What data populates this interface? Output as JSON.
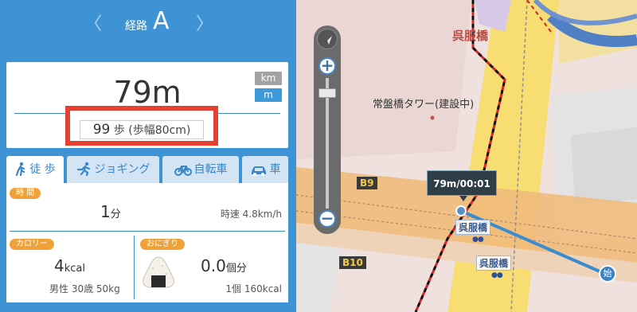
{
  "route": {
    "label": "経路",
    "letter": "A",
    "prev_icon": "chevron-left-icon",
    "next_icon": "chevron-right-icon",
    "prev_glyph": "〈",
    "next_glyph": "〉"
  },
  "distance": {
    "value": "79m",
    "unit_km": "km",
    "unit_m": "m",
    "selected_unit": "m"
  },
  "steps": {
    "count": "99",
    "unit": " 歩 ",
    "stride": "(歩幅80cm)",
    "highlight_color": "#e64033"
  },
  "tabs": [
    {
      "label": "徒 歩",
      "icon": "walk-icon",
      "active": true
    },
    {
      "label": "ジョギング",
      "icon": "jog-icon",
      "active": false
    },
    {
      "label": "自転車",
      "icon": "bicycle-icon",
      "active": false
    },
    {
      "label": "車",
      "icon": "car-icon",
      "active": false
    }
  ],
  "stats": {
    "time_label": "時 間",
    "time_value": "1",
    "time_unit": "分",
    "speed": "時速 4.8km/h",
    "calorie_label": "カロリー",
    "calorie_value": "4",
    "calorie_unit": "kcal",
    "calorie_sub": "男性 30歳 50kg",
    "rice_label": "おにぎり",
    "rice_icon": "onigiri-icon",
    "rice_value": "0.0",
    "rice_unit": "個分",
    "rice_sub": "1個 160kcal",
    "pill_color": "#f0a23a"
  },
  "map": {
    "label_gofuku_top": "呉服橋",
    "label_tower": "常盤橋タワー(建設中)",
    "label_b9": "B9",
    "label_b10": "B10",
    "station_label_1": "呉服橋",
    "station_label_2": "呉服橋",
    "station_dots": "●●",
    "tooltip": "79m/00:01",
    "start_label": "始",
    "zoom_in": "+",
    "zoom_out": "−",
    "compass_icon": "compass-arrow-icon",
    "route_color": "#3a8cd0"
  }
}
